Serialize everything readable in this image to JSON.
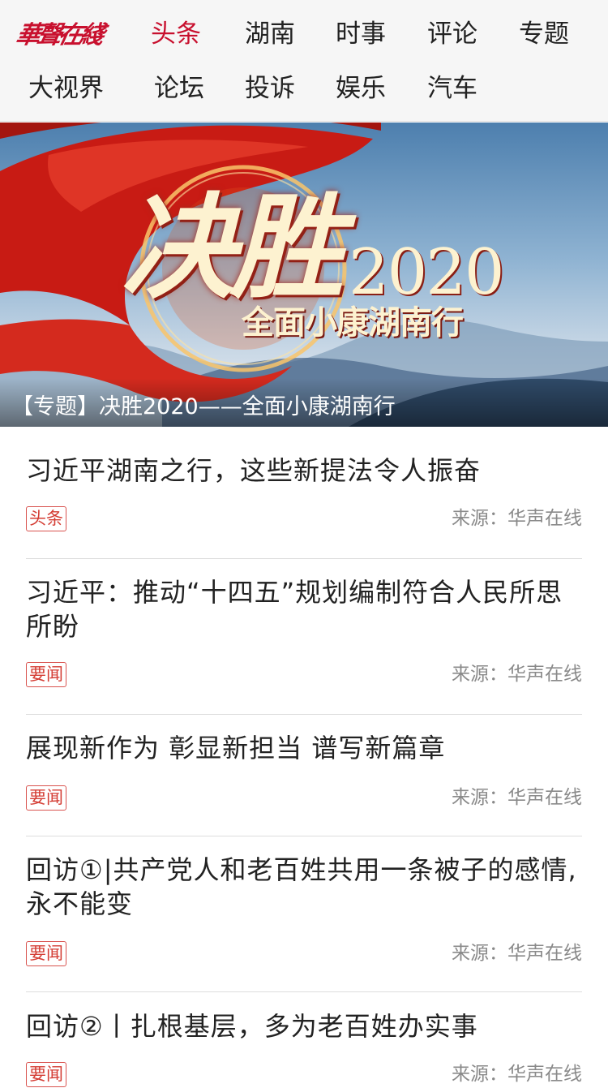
{
  "header": {
    "logo_text": "華聲在綫",
    "nav": [
      {
        "label": "头条",
        "active": true
      },
      {
        "label": "湖南",
        "active": false
      },
      {
        "label": "时事",
        "active": false
      },
      {
        "label": "评论",
        "active": false
      },
      {
        "label": "专题",
        "active": false
      },
      {
        "label": "大视界",
        "active": false
      },
      {
        "label": "论坛",
        "active": false
      },
      {
        "label": "投诉",
        "active": false
      },
      {
        "label": "娱乐",
        "active": false
      },
      {
        "label": "汽车",
        "active": false
      }
    ]
  },
  "banner": {
    "art_title": "决胜",
    "art_year": "2020",
    "art_subtitle": "全面小康湖南行",
    "caption": "【专题】决胜2020——全面小康湖南行"
  },
  "news": [
    {
      "title": "习近平湖南之行，这些新提法令人振奋",
      "tag": "头条",
      "source": "来源：华声在线"
    },
    {
      "title": "习近平：推动“十四五”规划编制符合人民所思所盼",
      "tag": "要闻",
      "source": "来源：华声在线"
    },
    {
      "title": "展现新作为 彰显新担当 谱写新篇章",
      "tag": "要闻",
      "source": "来源：华声在线"
    },
    {
      "title": "回访①|共产党人和老百姓共用一条被子的感情,永不能变",
      "tag": "要闻",
      "source": "来源：华声在线"
    },
    {
      "title": "回访②丨扎根基层，多为老百姓办实事",
      "tag": "要闻",
      "source": "来源：华声在线"
    }
  ],
  "colors": {
    "brand_red": "#c8102e",
    "tag_red": "#d43c33",
    "text_dark": "#222222",
    "text_meta": "#8a8a8a"
  }
}
